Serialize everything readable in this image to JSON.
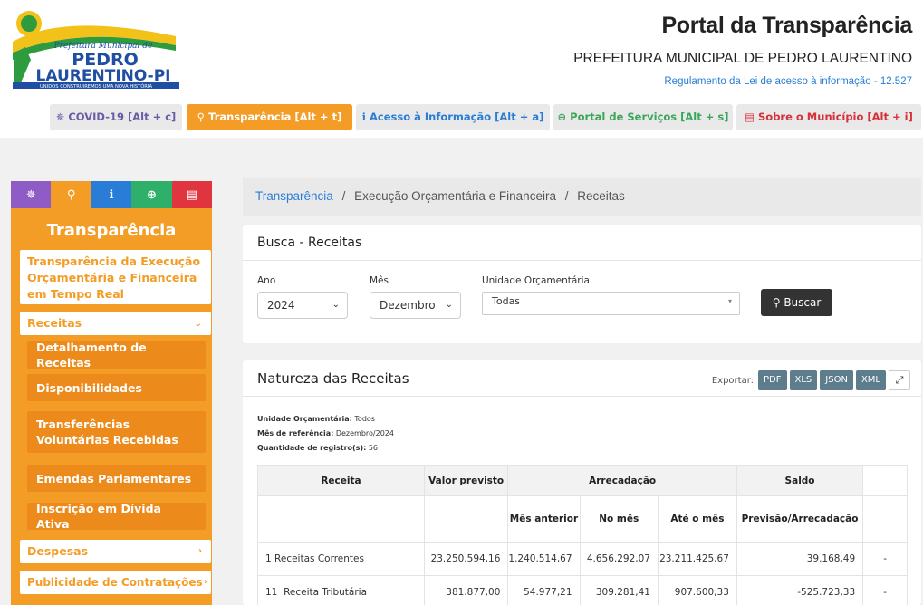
{
  "header": {
    "logo_line1": "Prefeitura Municipal de",
    "logo_line2": "PEDRO",
    "logo_line3": "LAURENTINO-PI",
    "logo_tagline": "UNIDOS CONSTRUIREMOS UMA NOVA HISTÓRIA",
    "title": "Portal da Transparência",
    "subtitle": "PREFEITURA MUNICIPAL DE PEDRO LAURENTINO",
    "law_link": "Regulamento da Lei de acesso à informação - 12.527"
  },
  "topnav": [
    {
      "label": "COVID-19 [Alt + c]",
      "icon": "virus-icon",
      "glyph": "✵",
      "bg": "#e9e9e9",
      "color": "#6b5aa8"
    },
    {
      "label": "Transparência [Alt + t]",
      "icon": "search-icon",
      "glyph": "⚲",
      "bg": "#f39c26",
      "color": "#ffffff"
    },
    {
      "label": "Acesso à Informação [Alt + a]",
      "icon": "info-icon",
      "glyph": "ℹ",
      "bg": "#e9e9e9",
      "color": "#2a7dd6"
    },
    {
      "label": "Portal de Serviços [Alt + s]",
      "icon": "globe-icon",
      "glyph": "⊕",
      "bg": "#e9e9e9",
      "color": "#3aa65a"
    },
    {
      "label": "Sobre o Município [Alt + i]",
      "icon": "card-icon",
      "glyph": "▤",
      "bg": "#e9e9e9",
      "color": "#d6303a"
    }
  ],
  "sidebar": {
    "title": "Transparência",
    "tab_colors": [
      "#8e5cc4",
      "#f39c26",
      "#2a7dd6",
      "#2fb06a",
      "#e0353f"
    ],
    "tab_glyphs": [
      "✵",
      "⚲",
      "ℹ",
      "⊕",
      "▤"
    ],
    "realtime": "Transparência da Execução Orçamentária e Financeira em Tempo Real",
    "receitas": "Receitas",
    "items": [
      "Detalhamento de Receitas",
      "Disponibilidades",
      "Transferências Voluntárias Recebidas",
      "Emendas Parlamentares",
      "Inscrição em Dívida Ativa"
    ],
    "despesas": "Despesas",
    "publicidade": "Publicidade de Contratações"
  },
  "breadcrumb": {
    "root": "Transparência",
    "sep": "/",
    "mid": "Execução Orçamentária e Financeira",
    "current": "Receitas"
  },
  "busca": {
    "title": "Busca - Receitas",
    "ano_label": "Ano",
    "ano_value": "2024",
    "mes_label": "Mês",
    "mes_value": "Dezembro",
    "unidade_label": "Unidade Orçamentária",
    "unidade_value": "Todas",
    "button": "Buscar"
  },
  "natureza": {
    "title": "Natureza das Receitas",
    "export_label": "Exportar:",
    "export_buttons": [
      "PDF",
      "XLS",
      "JSON",
      "XML"
    ],
    "meta_unidade_label": "Unidade Orçamentária:",
    "meta_unidade": "Todos",
    "meta_mes_label": "Mês de referência:",
    "meta_mes": "Dezembro/2024",
    "meta_qtd_label": "Quantidade de registro(s):",
    "meta_qtd": "56"
  },
  "table": {
    "h_receita": "Receita",
    "h_previsto": "Valor previsto",
    "h_arrecadacao": "Arrecadação",
    "h_saldo": "Saldo",
    "h_mes_anterior": "Mês anterior",
    "h_no_mes": "No mês",
    "h_ate_mes": "Até o mês",
    "h_prev_arrec": "Previsão/Arrecadação",
    "rows": [
      {
        "code": "1",
        "name": "Receitas Correntes",
        "previsto": "23.250.594,16",
        "mes_anterior": "1.240.514,67",
        "no_mes": "4.656.292,07",
        "ate_mes": "23.211.425,67",
        "saldo": "39.168,49",
        "extra": "-"
      },
      {
        "code": "11",
        "name": "Receita Tributária",
        "previsto": "381.877,00",
        "mes_anterior": "54.977,21",
        "no_mes": "309.281,41",
        "ate_mes": "907.600,33",
        "saldo": "-525.723,33",
        "extra": "-"
      }
    ]
  }
}
